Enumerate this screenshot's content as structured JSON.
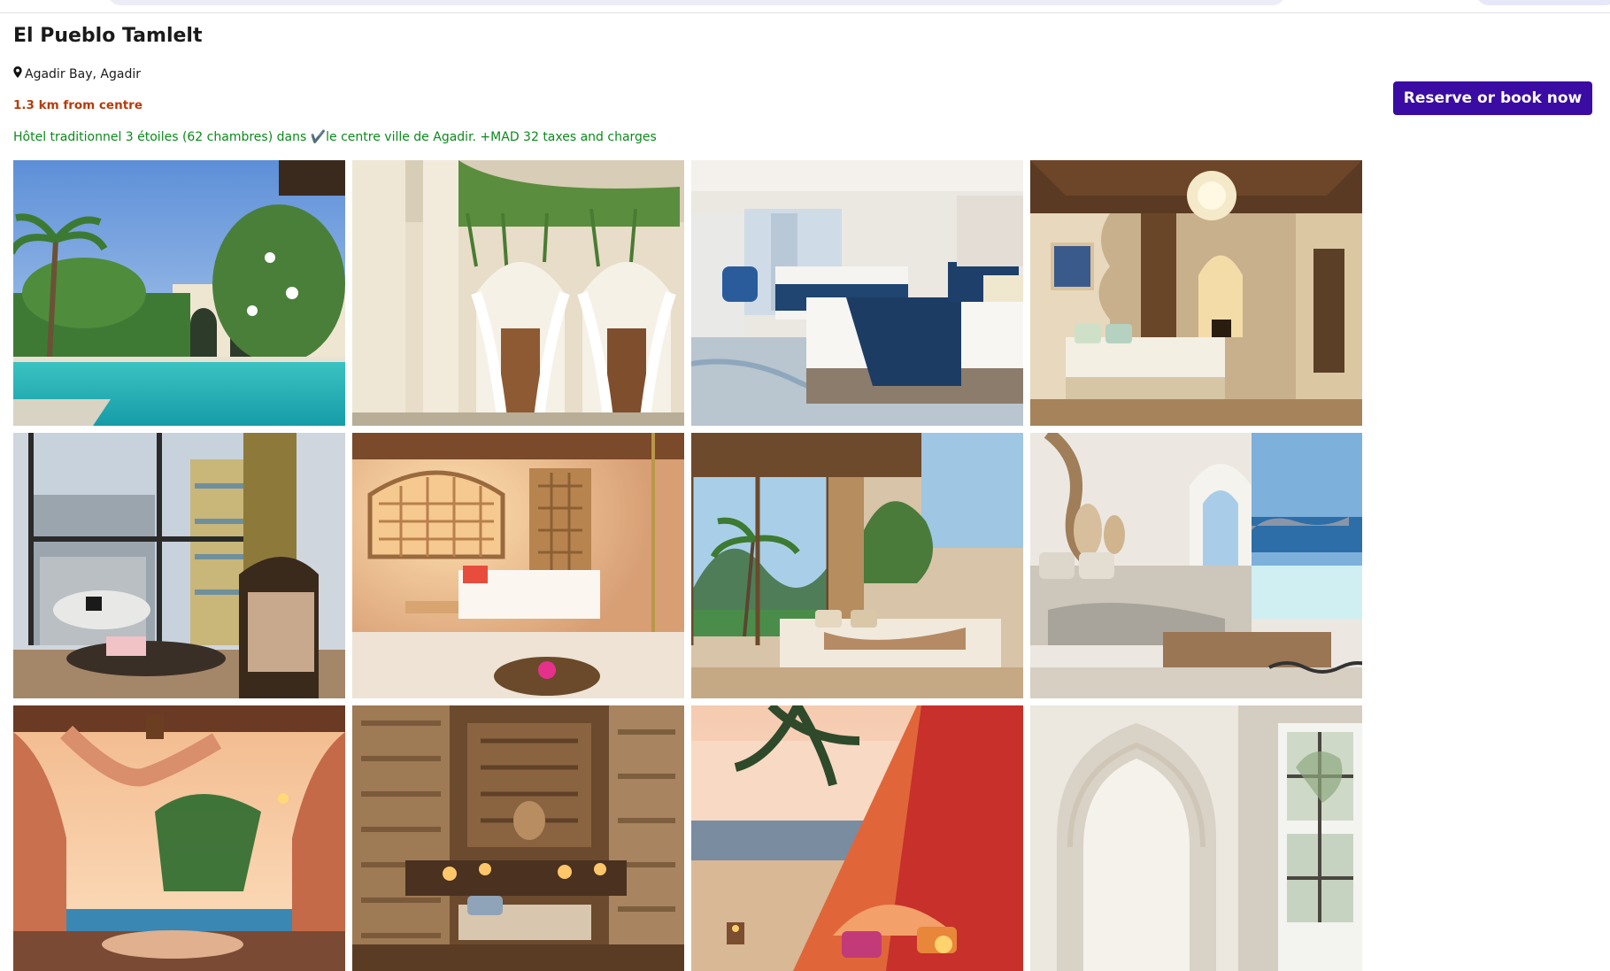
{
  "hotel": {
    "name": "El Pueblo Tamlelt",
    "location": "Agadir Bay, Agadir",
    "distance": "1.3 km from centre",
    "description_before_check": "Hôtel traditionnel 3 étoiles (62 chambres) dans ",
    "check_glyph": "✔️",
    "description_after_check": "le centre ville de Agadir. +MAD 32 taxes and charges"
  },
  "actions": {
    "reserve_label": "Reserve or book now"
  },
  "icons": {
    "location": "map-pin-icon"
  },
  "colors": {
    "primary_button": "#3a0ca3",
    "distance_text": "#b93a07",
    "description_text": "#0b8a1b"
  },
  "gallery": {
    "photos": [
      {
        "subject": "pool-with-palms"
      },
      {
        "subject": "moorish-arches-courtyard"
      },
      {
        "subject": "modern-twin-bedroom"
      },
      {
        "subject": "moroccan-suite-chandelier"
      },
      {
        "subject": "window-city-view-lounge"
      },
      {
        "subject": "lattice-screen-bedroom"
      },
      {
        "subject": "tropical-view-bedroom"
      },
      {
        "subject": "sea-view-white-bedroom"
      },
      {
        "subject": "beach-canopy-bed"
      },
      {
        "subject": "carved-stone-interior"
      },
      {
        "subject": "beach-tent-palm"
      },
      {
        "subject": "white-moorish-arch-window"
      }
    ]
  }
}
